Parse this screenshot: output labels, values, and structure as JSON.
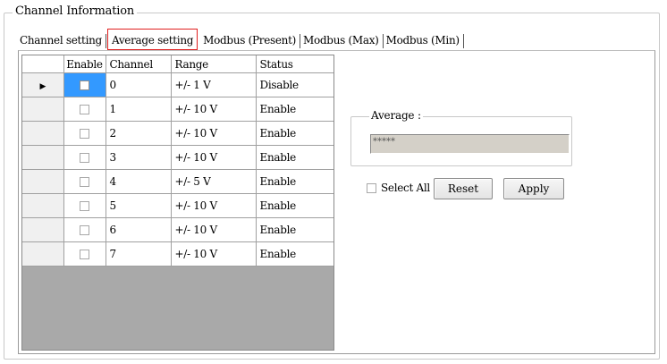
{
  "group": {
    "title": "Channel Information"
  },
  "tabs": [
    {
      "label": "Channel setting",
      "active": false
    },
    {
      "label": "Average setting",
      "active": true
    },
    {
      "label": "Modbus (Present)",
      "active": false
    },
    {
      "label": "Modbus (Max)",
      "active": false
    },
    {
      "label": "Modbus (Min)",
      "active": false
    }
  ],
  "grid": {
    "columns": [
      "Enable",
      "Channel",
      "Range",
      "Status"
    ],
    "current_row_marker": "▶",
    "rows": [
      {
        "enabled": false,
        "channel": "0",
        "range": "+/- 1 V",
        "status": "Disable"
      },
      {
        "enabled": false,
        "channel": "1",
        "range": "+/- 10 V",
        "status": "Enable"
      },
      {
        "enabled": false,
        "channel": "2",
        "range": "+/- 10 V",
        "status": "Enable"
      },
      {
        "enabled": false,
        "channel": "3",
        "range": "+/- 10 V",
        "status": "Enable"
      },
      {
        "enabled": false,
        "channel": "4",
        "range": "+/- 5 V",
        "status": "Enable"
      },
      {
        "enabled": false,
        "channel": "5",
        "range": "+/- 10 V",
        "status": "Enable"
      },
      {
        "enabled": false,
        "channel": "6",
        "range": "+/- 10 V",
        "status": "Enable"
      },
      {
        "enabled": false,
        "channel": "7",
        "range": "+/- 10 V",
        "status": "Enable"
      }
    ]
  },
  "average": {
    "title": "Average :",
    "value": "*****"
  },
  "controls": {
    "select_all_label": "Select All",
    "select_all_checked": false,
    "reset_label": "Reset",
    "apply_label": "Apply"
  },
  "colors": {
    "selection": "#3399ff",
    "active_tab_border": "#e02020",
    "grid_empty": "#a9a9a9"
  }
}
